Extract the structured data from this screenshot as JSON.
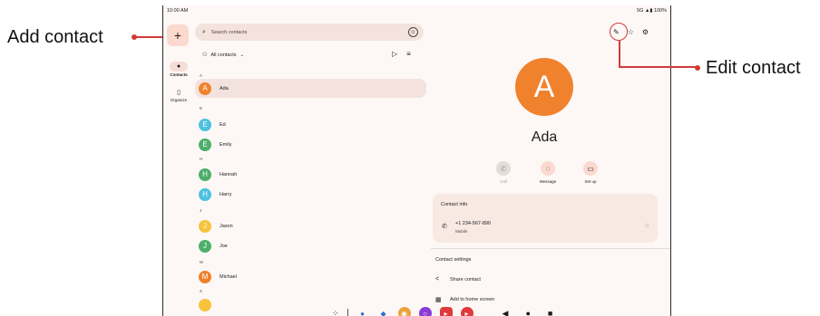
{
  "status": {
    "time": "10:00 AM",
    "right": "5G ▲▮ 100%"
  },
  "rail": {
    "fab_symbol": "+",
    "items": [
      {
        "label": "Contacts",
        "icon": "person-icon"
      },
      {
        "label": "Organize",
        "icon": "bookmark-icon"
      }
    ]
  },
  "search": {
    "placeholder": "Search contacts"
  },
  "filter": {
    "label": "All contacts",
    "chevron": "⌄"
  },
  "list": {
    "sections": [
      "A",
      "E",
      "H",
      "J",
      "M",
      "S"
    ],
    "contacts": [
      {
        "initial": "A",
        "name": "Ada",
        "color": "#f0822d"
      },
      {
        "initial": "E",
        "name": "Ed",
        "color": "#4cc1e0"
      },
      {
        "initial": "E",
        "name": "Emily",
        "color": "#4caf6a"
      },
      {
        "initial": "H",
        "name": "Hannah",
        "color": "#4caf6a"
      },
      {
        "initial": "H",
        "name": "Harry",
        "color": "#4cc1e0"
      },
      {
        "initial": "J",
        "name": "Jason",
        "color": "#f6c33b"
      },
      {
        "initial": "J",
        "name": "Joe",
        "color": "#4caf6a"
      },
      {
        "initial": "M",
        "name": "Michael",
        "color": "#f0822d"
      }
    ]
  },
  "detail": {
    "initial": "A",
    "name": "Ada",
    "actions": [
      {
        "label": "Call",
        "icon": "phone-icon"
      },
      {
        "label": "Message",
        "icon": "message-icon"
      },
      {
        "label": "Set up",
        "icon": "video-icon"
      }
    ],
    "contact_info": {
      "title": "Contact info",
      "phone": "+1 234-567-890",
      "type": "Mobile"
    },
    "settings": {
      "title": "Contact settings",
      "items": [
        "Share contact",
        "Add to home screen"
      ]
    }
  },
  "callouts": {
    "add": "Add contact",
    "edit": "Edit contact"
  },
  "colors": {
    "accent": "#d23a3a",
    "avatar_orange": "#f0822d",
    "fab": "#fbd9cf"
  }
}
